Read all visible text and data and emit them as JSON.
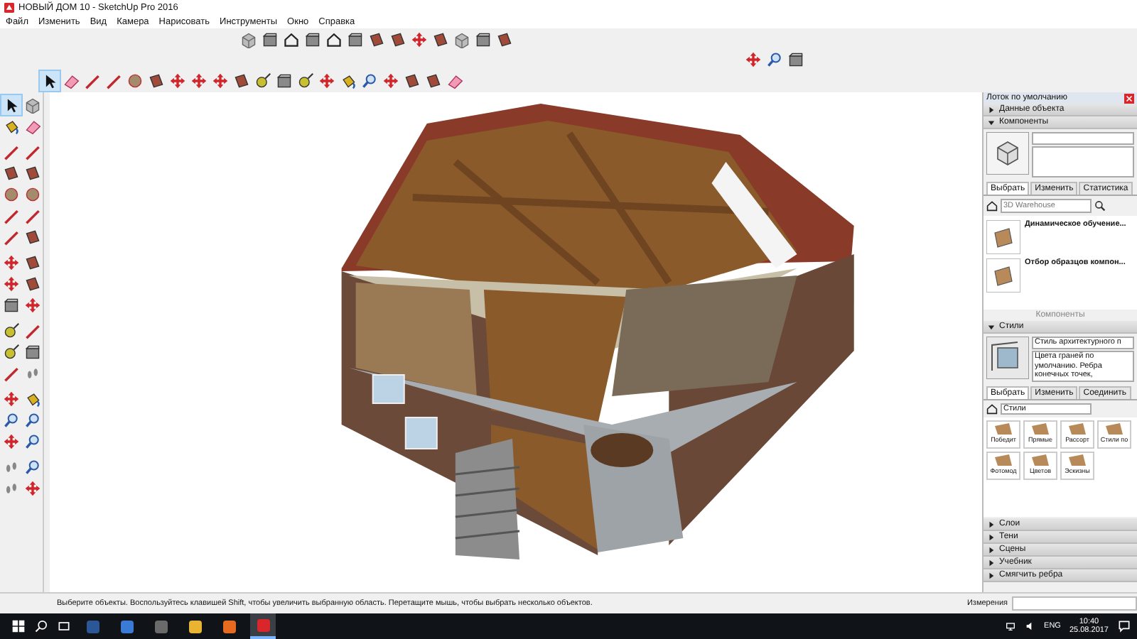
{
  "window": {
    "title": "НОВЫЙ ДОМ 10 - SketchUp Pro 2016"
  },
  "menu": [
    "Файл",
    "Изменить",
    "Вид",
    "Камера",
    "Нарисовать",
    "Инструменты",
    "Окно",
    "Справка"
  ],
  "toolbars": [
    {
      "items": [
        {
          "kind": "component",
          "selected": false
        },
        {
          "kind": "box",
          "selected": false
        },
        {
          "kind": "house",
          "selected": false
        },
        {
          "kind": "box",
          "selected": false
        },
        {
          "kind": "house",
          "selected": false
        },
        {
          "kind": "box",
          "selected": false
        },
        {
          "kind": "section",
          "selected": false
        },
        {
          "kind": "section",
          "selected": false
        },
        {
          "kind": "move",
          "selected": false
        },
        {
          "kind": "section",
          "selected": false
        },
        {
          "kind": "component",
          "selected": false
        },
        {
          "kind": "box",
          "selected": false
        },
        {
          "kind": "section",
          "selected": false
        }
      ]
    },
    {
      "items": [
        {
          "kind": "move",
          "selected": false
        },
        {
          "kind": "camera",
          "selected": false
        },
        {
          "kind": "box",
          "selected": false
        }
      ]
    },
    {
      "items": [
        {
          "kind": "select",
          "selected": true
        },
        {
          "kind": "eraser",
          "selected": false
        },
        {
          "kind": "draw",
          "selected": false
        },
        {
          "kind": "draw",
          "selected": false
        },
        {
          "kind": "shape",
          "selected": false
        },
        {
          "kind": "section",
          "selected": false
        },
        {
          "kind": "move",
          "selected": false
        },
        {
          "kind": "move",
          "selected": false
        },
        {
          "kind": "move",
          "selected": false
        },
        {
          "kind": "section",
          "selected": false
        },
        {
          "kind": "measure",
          "selected": false
        },
        {
          "kind": "box",
          "selected": false
        },
        {
          "kind": "measure",
          "selected": false
        },
        {
          "kind": "move",
          "selected": false
        },
        {
          "kind": "paint",
          "selected": false
        },
        {
          "kind": "camera",
          "selected": false
        },
        {
          "kind": "move",
          "selected": false
        },
        {
          "kind": "section",
          "selected": false
        },
        {
          "kind": "section",
          "selected": false
        },
        {
          "kind": "eraser",
          "selected": false
        }
      ]
    }
  ],
  "left_toolbar": {
    "groups": [
      {
        "items": [
          {
            "kind": "select",
            "selected": true
          },
          {
            "kind": "component",
            "selected": false
          },
          {
            "kind": "paint",
            "selected": false
          },
          {
            "kind": "eraser",
            "selected": false
          }
        ]
      },
      {
        "items": [
          {
            "kind": "draw",
            "selected": false
          },
          {
            "kind": "draw",
            "selected": false
          },
          {
            "kind": "section",
            "selected": false
          },
          {
            "kind": "section",
            "selected": false
          },
          {
            "kind": "shape",
            "selected": false
          },
          {
            "kind": "shape",
            "selected": false
          },
          {
            "kind": "draw",
            "selected": false
          },
          {
            "kind": "draw",
            "selected": false
          },
          {
            "kind": "draw",
            "selected": false
          },
          {
            "kind": "section",
            "selected": false
          }
        ]
      },
      {
        "items": [
          {
            "kind": "move",
            "selected": false
          },
          {
            "kind": "section",
            "selected": false
          },
          {
            "kind": "move",
            "selected": false
          },
          {
            "kind": "section",
            "selected": false
          },
          {
            "kind": "box",
            "selected": false
          },
          {
            "kind": "move",
            "selected": false
          }
        ]
      },
      {
        "items": [
          {
            "kind": "measure",
            "selected": false
          },
          {
            "kind": "draw",
            "selected": false
          },
          {
            "kind": "measure",
            "selected": false
          },
          {
            "kind": "box",
            "selected": false
          },
          {
            "kind": "draw",
            "selected": false
          },
          {
            "kind": "walk",
            "selected": false
          }
        ]
      },
      {
        "items": [
          {
            "kind": "move",
            "selected": false
          },
          {
            "kind": "paint",
            "selected": false
          },
          {
            "kind": "camera",
            "selected": false
          },
          {
            "kind": "camera",
            "selected": false
          },
          {
            "kind": "move",
            "selected": false
          },
          {
            "kind": "camera",
            "selected": false
          }
        ]
      },
      {
        "items": [
          {
            "kind": "walk",
            "selected": false
          },
          {
            "kind": "camera",
            "selected": false
          },
          {
            "kind": "walk",
            "selected": false
          },
          {
            "kind": "move",
            "selected": false
          }
        ]
      }
    ]
  },
  "tray": {
    "title": "Лоток по умолчанию",
    "panels": [
      {
        "title": "Данные объекта",
        "expanded": false
      },
      {
        "kind": "components",
        "title": "Компоненты",
        "expanded": true,
        "tabs": [
          {
            "label": "Выбрать",
            "selected": true
          },
          {
            "label": "Изменить",
            "selected": false
          },
          {
            "label": "Статистика",
            "selected": false
          }
        ],
        "search": {
          "placeholder": "3D Warehouse"
        },
        "items": [
          {
            "title": "Динамическое обучение..."
          },
          {
            "title": "Отбор образцов компон..."
          }
        ],
        "footer": "Компоненты"
      },
      {
        "kind": "styles",
        "title": "Стили",
        "expanded": true,
        "style_name": "Стиль архитектурного п",
        "description": "Цвета граней по умолчанию. Ребра конечных точек,",
        "tabs": [
          {
            "label": "Выбрать",
            "selected": true
          },
          {
            "label": "Изменить",
            "selected": false
          },
          {
            "label": "Соединить",
            "selected": false
          }
        ],
        "dropdown": "Стили",
        "thumbnails": [
          {
            "label": "Победит"
          },
          {
            "label": "Прямые"
          },
          {
            "label": "Рассорт"
          },
          {
            "label": "Стили по"
          },
          {
            "label": "Фотомод"
          },
          {
            "label": "Цветов"
          },
          {
            "label": "Эскизны"
          }
        ]
      },
      {
        "title": "Слои",
        "expanded": false
      },
      {
        "title": "Тени",
        "expanded": false
      },
      {
        "title": "Сцены",
        "expanded": false
      },
      {
        "title": "Учебник",
        "expanded": false
      },
      {
        "title": "Смягчить ребра",
        "expanded": false
      }
    ]
  },
  "status_bar": {
    "hint": "Выберите объекты. Воспользуйтесь клавишей Shift, чтобы увеличить выбранную область. Перетащите мышь, чтобы выбрать несколько объектов.",
    "measurements_label": "Измерения"
  },
  "taskbar": {
    "apps": [
      {
        "kind": "document",
        "selected": false
      },
      {
        "kind": "photos",
        "selected": false
      },
      {
        "kind": "media",
        "selected": false
      },
      {
        "kind": "explorer",
        "selected": false
      },
      {
        "kind": "browser",
        "selected": false
      },
      {
        "kind": "sketchup",
        "selected": true
      }
    ],
    "language": "ENG",
    "time": "10:40",
    "date": "25.08.2017"
  }
}
